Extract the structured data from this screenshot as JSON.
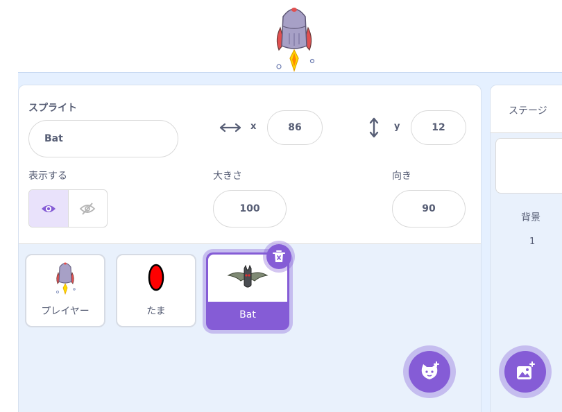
{
  "stage": {
    "sprite": "rocket-sprite"
  },
  "sprite_info": {
    "sprite_label": "スプライト",
    "name_value": "Bat",
    "x_label": "x",
    "x_value": "86",
    "y_label": "y",
    "y_value": "12",
    "show_label": "表示する",
    "size_label": "大きさ",
    "size_value": "100",
    "direction_label": "向き",
    "direction_value": "90"
  },
  "sprites": [
    {
      "name": "プレイヤー",
      "icon": "rocket-thumbnail",
      "selected": false
    },
    {
      "name": "たま",
      "icon": "red-oval-thumbnail",
      "selected": false
    },
    {
      "name": "Bat",
      "icon": "bat-thumbnail",
      "selected": true
    }
  ],
  "stage_panel": {
    "title": "ステージ",
    "backdrops_label": "背景",
    "backdrops_count": "1"
  },
  "colors": {
    "accent": "#855cd6",
    "text": "#575e75",
    "pane_bg": "#e9f1fc"
  }
}
